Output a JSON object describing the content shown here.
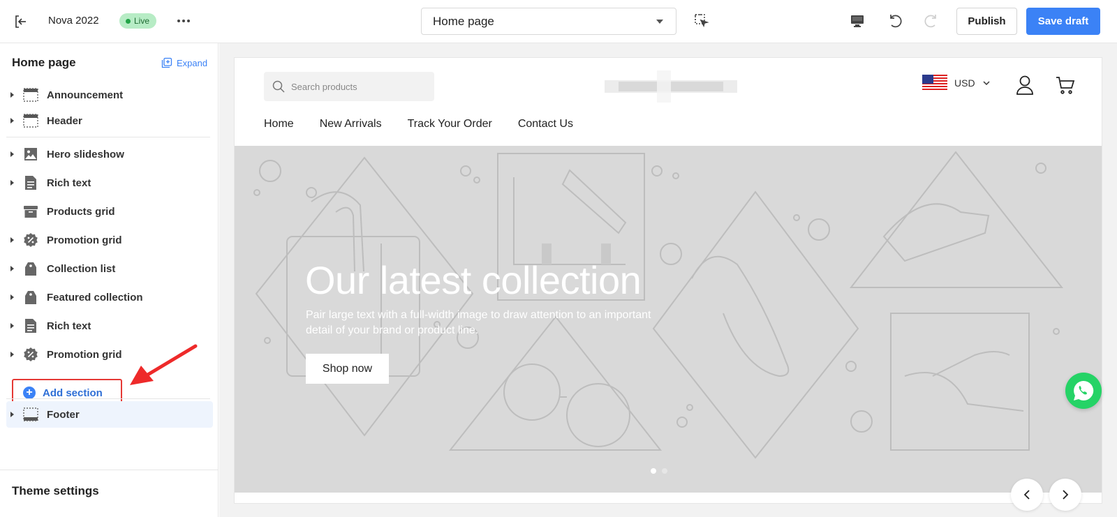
{
  "topbar": {
    "theme_name": "Nova 2022",
    "status_badge": "Live",
    "page_select": "Home page",
    "publish_label": "Publish",
    "save_label": "Save draft",
    "accent_color": "#3b82f6",
    "icons": [
      "exit-icon",
      "more-icon",
      "chevron-down-icon",
      "inspect-icon",
      "desktop-icon",
      "undo-icon",
      "redo-icon"
    ]
  },
  "sidebar": {
    "title": "Home page",
    "expand_label": "Expand",
    "header_group": [
      {
        "label": "Announcement",
        "icon": "section-layout-icon"
      },
      {
        "label": "Header",
        "icon": "header-layout-icon"
      }
    ],
    "sections": [
      {
        "label": "Hero slideshow",
        "icon": "image-icon"
      },
      {
        "label": "Rich text",
        "icon": "document-icon"
      },
      {
        "label": "Products grid",
        "icon": "box-icon"
      },
      {
        "label": "Promotion grid",
        "icon": "discount-icon"
      },
      {
        "label": "Collection list",
        "icon": "tag-icon"
      },
      {
        "label": "Featured collection",
        "icon": "tag-icon"
      },
      {
        "label": "Rich text",
        "icon": "document-icon"
      },
      {
        "label": "Promotion grid",
        "icon": "discount-icon"
      }
    ],
    "add_section_label": "Add section",
    "footer_label": "Footer",
    "theme_settings_label": "Theme settings"
  },
  "storefront": {
    "search_placeholder": "Search products",
    "currency": "USD",
    "nav": [
      "Home",
      "New Arrivals",
      "Track Your Order",
      "Contact Us"
    ],
    "hero": {
      "title": "Our latest collection",
      "subtitle": "Pair large text with a full-width image to draw attention to an important detail of your brand or product line.",
      "button": "Shop now",
      "slides": 2,
      "active_slide": 1
    }
  }
}
